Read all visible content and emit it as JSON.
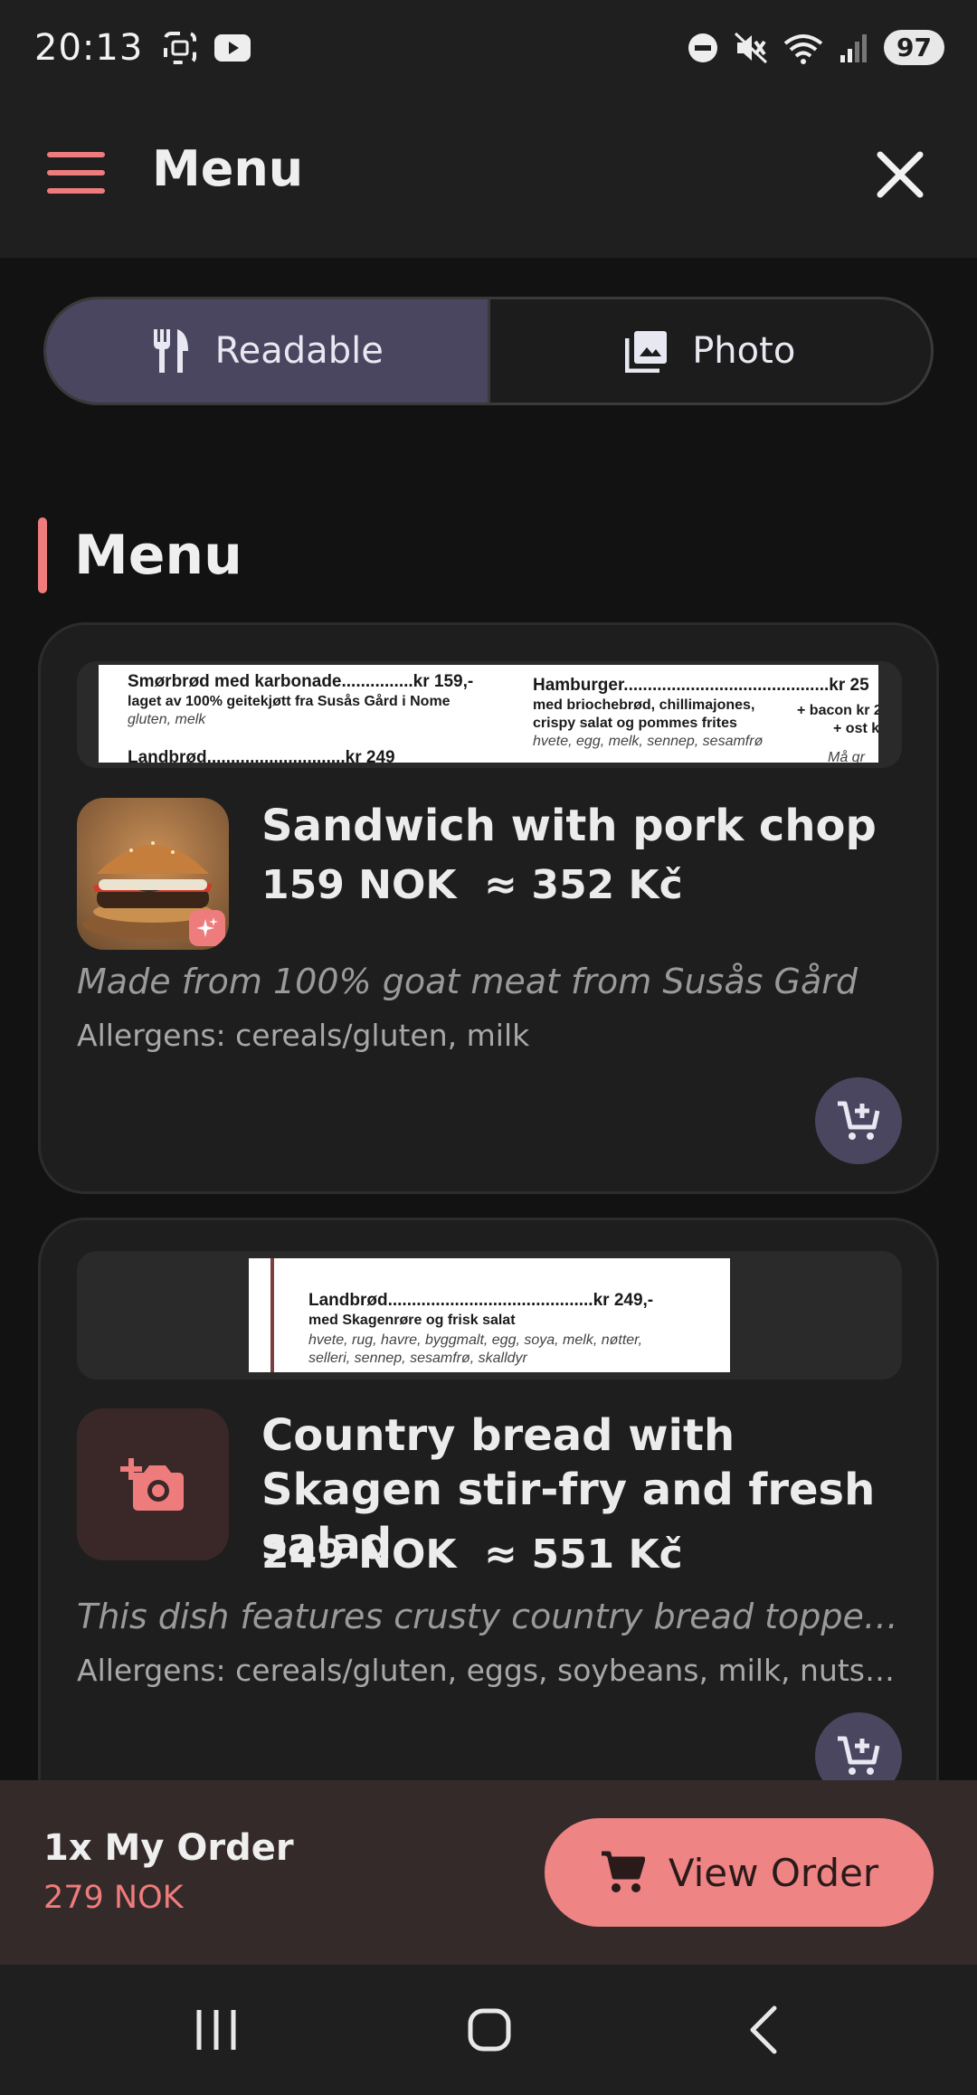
{
  "status_bar": {
    "time": "20:13",
    "battery": "97",
    "icons": [
      "screenshot-icon",
      "youtube-icon",
      "dnd-icon",
      "mute-icon",
      "wifi-icon",
      "signal-icon"
    ]
  },
  "app_bar": {
    "title": "Menu",
    "menu_icon": "hamburger-icon",
    "close_icon": "close-icon"
  },
  "view_toggle": {
    "options": [
      {
        "label": "Readable",
        "icon": "cutlery-icon",
        "active": true
      },
      {
        "label": "Photo",
        "icon": "photo-icon",
        "active": false
      }
    ]
  },
  "section": {
    "title": "Menu"
  },
  "items": [
    {
      "menu_snippet": {
        "col1_title": "Smørbrød med karbonade...............kr 159,-",
        "col1_sub": "laget av 100% geitekjøtt fra Susås Gård i Nome",
        "col1_allergens": "gluten, melk",
        "col1_next": "Landbrød.............................kr 249",
        "col2_title": "Hamburger...........................................kr 25",
        "col2_sub1": "med briochebrød, chillimajones,",
        "col2_sub2": "crispy salat og pommes frites",
        "col2_allergens": "hvete, egg, melk, sennep, sesamfrø",
        "col2_extra1": "+ bacon kr 2",
        "col2_extra2": "+ ost kr",
        "col2_extra3": "Må gr"
      },
      "name": "Sandwich with pork chop",
      "price": "159 NOK",
      "converted_price": "≈ 352 Kč",
      "description": "Made from 100% goat meat from Susås Gård",
      "allergens": "Allergens: cereals/gluten, milk",
      "thumbnail": "burger-photo"
    },
    {
      "menu_snippet": {
        "title": "Landbrød...........................................kr 249,-",
        "sub": "med Skagenrøre og frisk salat",
        "allergens1": "hvete, rug, havre, byggmalt, egg, soya, melk, nøtter,",
        "allergens2": "selleri, sennep, sesamfrø, skalldyr"
      },
      "name": "Country bread with Skagen stir-fry and fresh salad",
      "price": "249 NOK",
      "converted_price": "≈ 551 Kč",
      "description": "This dish features crusty country bread topped with Skagen stir-fry and fresh salad",
      "allergens": "Allergens: cereals/gluten, eggs, soybeans, milk, nuts, celery, mustard, sesame seeds, shellfish",
      "thumbnail": "add-photo-icon"
    }
  ],
  "order_bar": {
    "title": "1x My Order",
    "total": "279 NOK",
    "button_label": "View Order"
  },
  "colors": {
    "accent": "#ef7c7c",
    "active_toggle": "#4a4660",
    "background": "#121212",
    "card": "#1e1e1e"
  }
}
